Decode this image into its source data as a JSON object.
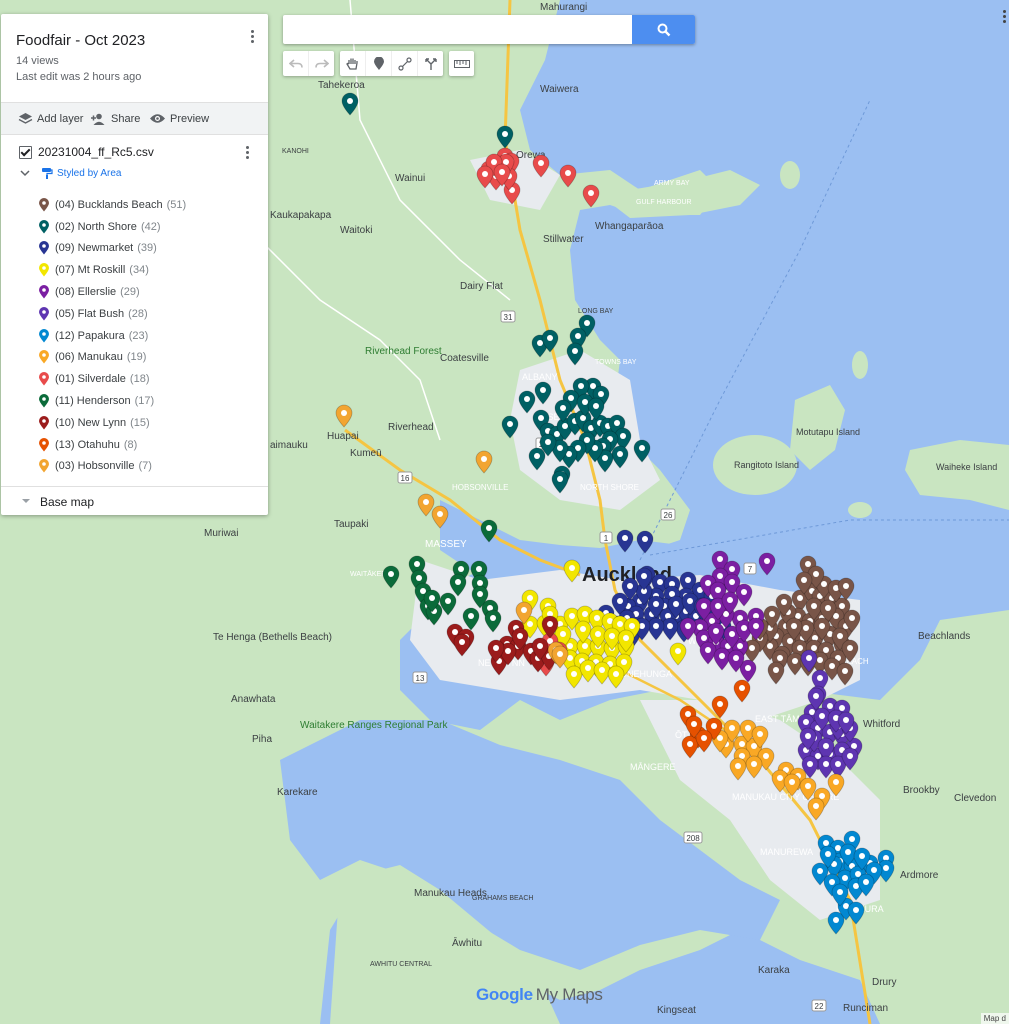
{
  "map_title": "Foodfair - Oct 2023",
  "views": "14 views",
  "last_edit": "Last edit was 2 hours ago",
  "actions": {
    "add_layer": "Add layer",
    "share": "Share",
    "preview": "Preview"
  },
  "layer": {
    "name": "20231004_ff_Rc5.csv",
    "style": "Styled by Area"
  },
  "legend": [
    {
      "label": "(04) Bucklands Beach",
      "count": "(51)",
      "color": "#795548"
    },
    {
      "label": "(02) North Shore",
      "count": "(42)",
      "color": "#006064"
    },
    {
      "label": "(09) Newmarket",
      "count": "(39)",
      "color": "#283593"
    },
    {
      "label": "(07) Mt Roskill",
      "count": "(34)",
      "color": "#f2e600"
    },
    {
      "label": "(08) Ellerslie",
      "count": "(29)",
      "color": "#7b1fa2"
    },
    {
      "label": "(05) Flat Bush",
      "count": "(28)",
      "color": "#5e35b1"
    },
    {
      "label": "(12) Papakura",
      "count": "(23)",
      "color": "#0288d1"
    },
    {
      "label": "(06) Manukau",
      "count": "(19)",
      "color": "#f9a825"
    },
    {
      "label": "(01) Silverdale",
      "count": "(18)",
      "color": "#e84b4b"
    },
    {
      "label": "(11) Henderson",
      "count": "(17)",
      "color": "#0b6b3a"
    },
    {
      "label": "(10) New Lynn",
      "count": "(15)",
      "color": "#9b1c1c"
    },
    {
      "label": "(13) Otahuhu",
      "count": "(8)",
      "color": "#e65100"
    },
    {
      "label": "(03) Hobsonville",
      "count": "(7)",
      "color": "#f2a531"
    }
  ],
  "base_map": "Base map",
  "search": {
    "placeholder": ""
  },
  "tools": [
    "undo-icon",
    "redo-icon",
    "hand-icon",
    "marker-icon",
    "draw-line-icon",
    "route-icon",
    "ruler-icon"
  ],
  "place_labels": [
    {
      "text": "Mahurangi"
    },
    {
      "text": "Tahekeroa"
    },
    {
      "text": "Waiwera"
    },
    {
      "text": "Orewa"
    },
    {
      "text": "KANOHI"
    },
    {
      "text": "Wainui"
    },
    {
      "text": "ARMY BAY"
    },
    {
      "text": "GULF HARBOUR"
    },
    {
      "text": "Kaukapakapa"
    },
    {
      "text": "Waitoki"
    },
    {
      "text": "Stillwater"
    },
    {
      "text": "Whangaparāoa"
    },
    {
      "text": "Dairy Flat"
    },
    {
      "text": "LONG BAY"
    },
    {
      "text": "Riverhead Forest"
    },
    {
      "text": "Coatesville"
    },
    {
      "text": "ALBANY"
    },
    {
      "text": "TOWNS BAY"
    },
    {
      "text": "ROSEDALE"
    },
    {
      "text": "Riverhead"
    },
    {
      "text": "Huapai"
    },
    {
      "text": "aimauku"
    },
    {
      "text": "Kumeū"
    },
    {
      "text": "HOBSONVILLE"
    },
    {
      "text": "NORTH SHORE"
    },
    {
      "text": "Taupaki"
    },
    {
      "text": "Muriwai"
    },
    {
      "text": "MASSEY"
    },
    {
      "text": "WAITĀKERE"
    },
    {
      "text": "Auckland"
    },
    {
      "text": "NEW LYNN"
    },
    {
      "text": "WELLINGTON"
    },
    {
      "text": "ONEHUNGA"
    },
    {
      "text": "Te Henga (Bethells Beach)"
    },
    {
      "text": "Anawhata"
    },
    {
      "text": "Waitakere Ranges Regional Park"
    },
    {
      "text": "Piha"
    },
    {
      "text": "Karekare"
    },
    {
      "text": "EAST TĀMAKI"
    },
    {
      "text": "ŌTĀHUHU"
    },
    {
      "text": "MĀNGERE"
    },
    {
      "text": "MANUKAU CITY CENTRE"
    },
    {
      "text": "MANUREWA"
    },
    {
      "text": "PAPAKURA"
    },
    {
      "text": "Ardmore"
    },
    {
      "text": "Whitford"
    },
    {
      "text": "Brookby"
    },
    {
      "text": "Clevedon"
    },
    {
      "text": "Beachlands"
    },
    {
      "text": "Motutapu Island"
    },
    {
      "text": "Rangitoto Island"
    },
    {
      "text": "Waiheke Island"
    },
    {
      "text": "Manukau Heads"
    },
    {
      "text": "GRAHAMS BEACH"
    },
    {
      "text": "Āwhitu"
    },
    {
      "text": "AWHITU CENTRAL"
    },
    {
      "text": "Karaka"
    },
    {
      "text": "Drury"
    },
    {
      "text": "Kingseat"
    },
    {
      "text": "Runciman"
    },
    {
      "text": "BUCKLANDS BEACH"
    }
  ],
  "road_labels": [
    {
      "text": "1"
    },
    {
      "text": "16"
    },
    {
      "text": "18"
    },
    {
      "text": "20"
    },
    {
      "text": "22"
    },
    {
      "text": "31"
    },
    {
      "text": "26"
    },
    {
      "text": "7"
    },
    {
      "text": "208"
    },
    {
      "text": "13"
    }
  ],
  "logo": {
    "google": "Google",
    "my_maps": "My Maps"
  },
  "map_data": "Map d",
  "colors": {
    "water": "#9bbff2",
    "land": "#c9e5c1",
    "urban": "#e8ebef",
    "accent": "#4d8ef0"
  }
}
